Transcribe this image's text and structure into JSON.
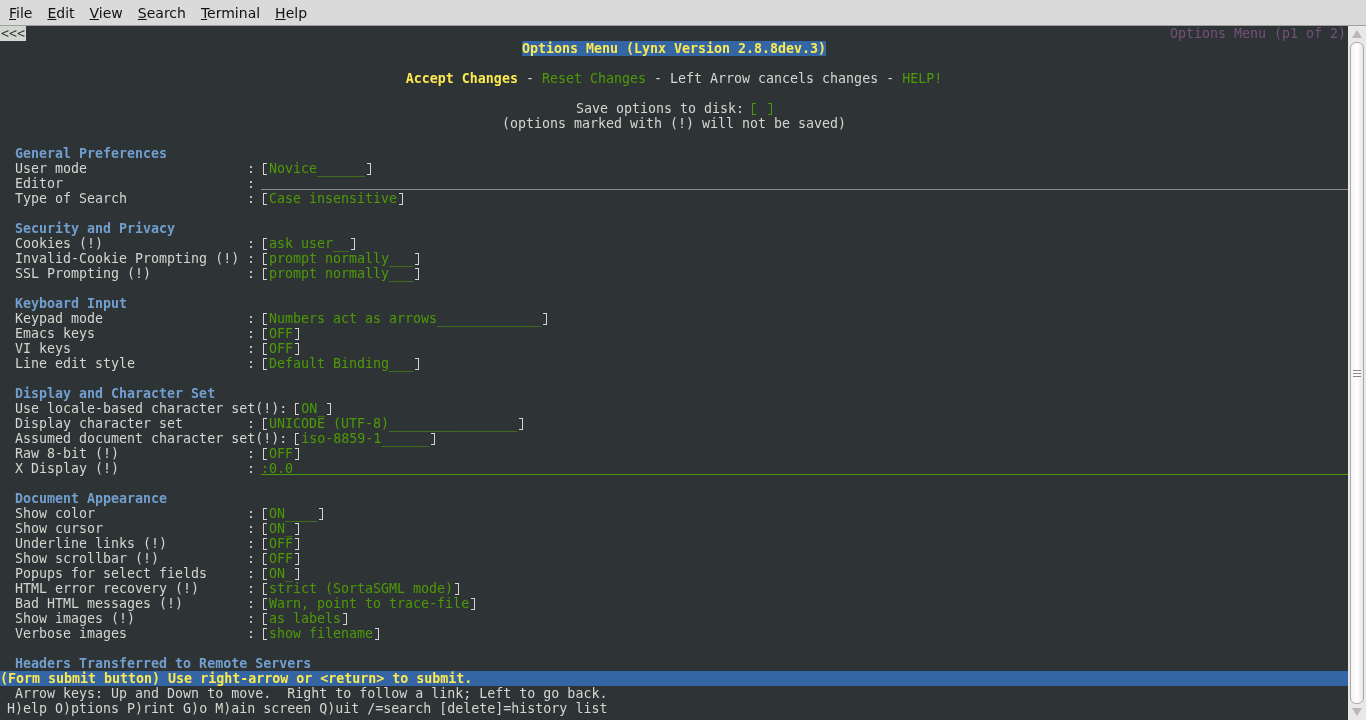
{
  "menu": [
    "File",
    "Edit",
    "View",
    "Search",
    "Terminal",
    "Help"
  ],
  "back_link": "<<<",
  "page_title": "Options Menu (p1 of 2)",
  "heading": "Options Menu (Lynx Version 2.8.8dev.3)",
  "actions": [
    {
      "text": "Accept Changes",
      "kind": "active"
    },
    {
      "text": "-",
      "kind": "text"
    },
    {
      "text": "Reset Changes",
      "kind": "link"
    },
    {
      "text": "-",
      "kind": "text"
    },
    {
      "text": "Left Arrow cancels changes",
      "kind": "text"
    },
    {
      "text": "-",
      "kind": "text"
    },
    {
      "text": "HELP!",
      "kind": "link"
    }
  ],
  "save": {
    "label": "Save options to disk:",
    "checked": false
  },
  "note": "(options marked with (!) will not be saved)",
  "sections": [
    {
      "title": "General Preferences",
      "options": [
        {
          "label": "User mode",
          "sep": ":",
          "kind": "select",
          "value": "Novice______"
        },
        {
          "label": "Editor",
          "sep": ":",
          "kind": "text"
        },
        {
          "label": "Type of Search",
          "sep": ":",
          "kind": "select",
          "value": "Case insensitive"
        }
      ]
    },
    {
      "title": "Security and Privacy",
      "options": [
        {
          "label": "Cookies (!)",
          "sep": ":",
          "kind": "select",
          "value": "ask user__"
        },
        {
          "label": "Invalid-Cookie Prompting (!)",
          "sep": ":",
          "kind": "select",
          "value": "prompt normally___"
        },
        {
          "label": "SSL Prompting (!)",
          "sep": ":",
          "kind": "select",
          "value": "prompt normally___"
        }
      ]
    },
    {
      "title": "Keyboard Input",
      "options": [
        {
          "label": "Keypad mode",
          "sep": ":",
          "kind": "select",
          "value": "Numbers act as arrows_____________"
        },
        {
          "label": "Emacs keys",
          "sep": ":",
          "kind": "select",
          "value": "OFF"
        },
        {
          "label": "VI keys",
          "sep": ":",
          "kind": "select",
          "value": "OFF"
        },
        {
          "label": "Line edit style",
          "sep": ":",
          "kind": "select",
          "value": "Default Binding___"
        }
      ]
    },
    {
      "title": "Display and Character Set",
      "options": [
        {
          "label": "Use locale-based character set(!)",
          "sep": ":",
          "kind": "select",
          "value": "ON_"
        },
        {
          "label": "Display character set",
          "sep": ":",
          "kind": "select",
          "value": "UNICODE (UTF-8)________________"
        },
        {
          "label": "Assumed document character set(!)",
          "sep": ":",
          "kind": "select",
          "value": "iso-8859-1______"
        },
        {
          "label": "Raw 8-bit (!)",
          "sep": ":",
          "kind": "select",
          "value": "OFF"
        },
        {
          "label": "X Display (!)",
          "sep": ":",
          "kind": "text",
          "value": ":0.0"
        }
      ]
    },
    {
      "title": "Document Appearance",
      "options": [
        {
          "label": "Show color",
          "sep": ":",
          "kind": "select",
          "value": "ON____"
        },
        {
          "label": "Show cursor",
          "sep": ":",
          "kind": "select",
          "value": "ON_"
        },
        {
          "label": "Underline links (!)",
          "sep": ":",
          "kind": "select",
          "value": "OFF"
        },
        {
          "label": "Show scrollbar (!)",
          "sep": ":",
          "kind": "select",
          "value": "OFF"
        },
        {
          "label": "Popups for select fields",
          "sep": ":",
          "kind": "select",
          "value": "ON_"
        },
        {
          "label": "HTML error recovery (!)",
          "sep": ":",
          "kind": "select",
          "value": "strict (SortaSGML mode)"
        },
        {
          "label": "Bad HTML messages (!)",
          "sep": ":",
          "kind": "select",
          "value": "Warn, point to trace-file"
        },
        {
          "label": "Show images (!)",
          "sep": ":",
          "kind": "select",
          "value": "as labels"
        },
        {
          "label": "Verbose images",
          "sep": ":",
          "kind": "select",
          "value": "show filename"
        }
      ]
    },
    {
      "title": "Headers Transferred to Remote Servers"
    }
  ],
  "status": "(Form submit button) Use right-arrow or <return> to submit.",
  "help_lines": [
    "Arrow keys: Up and Down to move.  Right to follow a link; Left to go back.",
    "H)elp O)ptions P)rint G)o M)ain screen Q)uit /=search [delete]=history list"
  ]
}
